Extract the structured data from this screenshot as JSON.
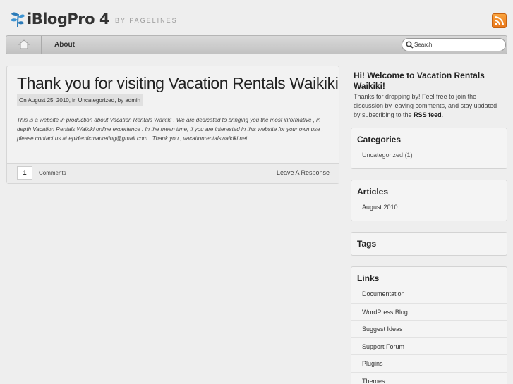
{
  "header": {
    "logo_text": "iBlogPro 4",
    "logo_sub": "BY PAGELINES",
    "rss_icon": "rss-icon"
  },
  "nav": {
    "home_icon": "home-icon",
    "about_label": "About",
    "search_placeholder": "Search"
  },
  "post": {
    "title": "Thank you for visiting Vacation Rentals Waikiki",
    "meta": "On August 25, 2010, in Uncategorized, by admin",
    "body": "This is a website in production about Vacation Rentals Waikiki . We are dedicated to bringing you the most informative , in depth Vacation Rentals Waikiki online experience . In the mean time, if you are interested in this website for your own use , please contact us at epidemicmarketing@gmail.com . Thank you , vacationrentalswaikiki.net",
    "comment_count": "1",
    "comments_label": "Comments",
    "leave_response_label": "Leave A Response"
  },
  "sidebar": {
    "welcome_title": "Hi! Welcome to Vacation Rentals Waikiki!",
    "welcome_text": "Thanks for dropping by! Feel free to join the discussion by leaving comments, and stay updated by subscribing to the ",
    "welcome_link": "RSS feed",
    "welcome_end": ".",
    "categories": {
      "title": "Categories",
      "items": [
        {
          "label": "Uncategorized",
          "count": "(1)"
        }
      ]
    },
    "articles": {
      "title": "Articles",
      "items": [
        "August 2010"
      ]
    },
    "tags": {
      "title": "Tags"
    },
    "links": {
      "title": "Links",
      "items": [
        "Documentation",
        "WordPress Blog",
        "Suggest Ideas",
        "Support Forum",
        "Plugins",
        "Themes"
      ]
    }
  },
  "colors": {
    "background": "#eeeeee",
    "rss_orange": "#f28c28",
    "logo_blue": "#2a7ab8"
  }
}
